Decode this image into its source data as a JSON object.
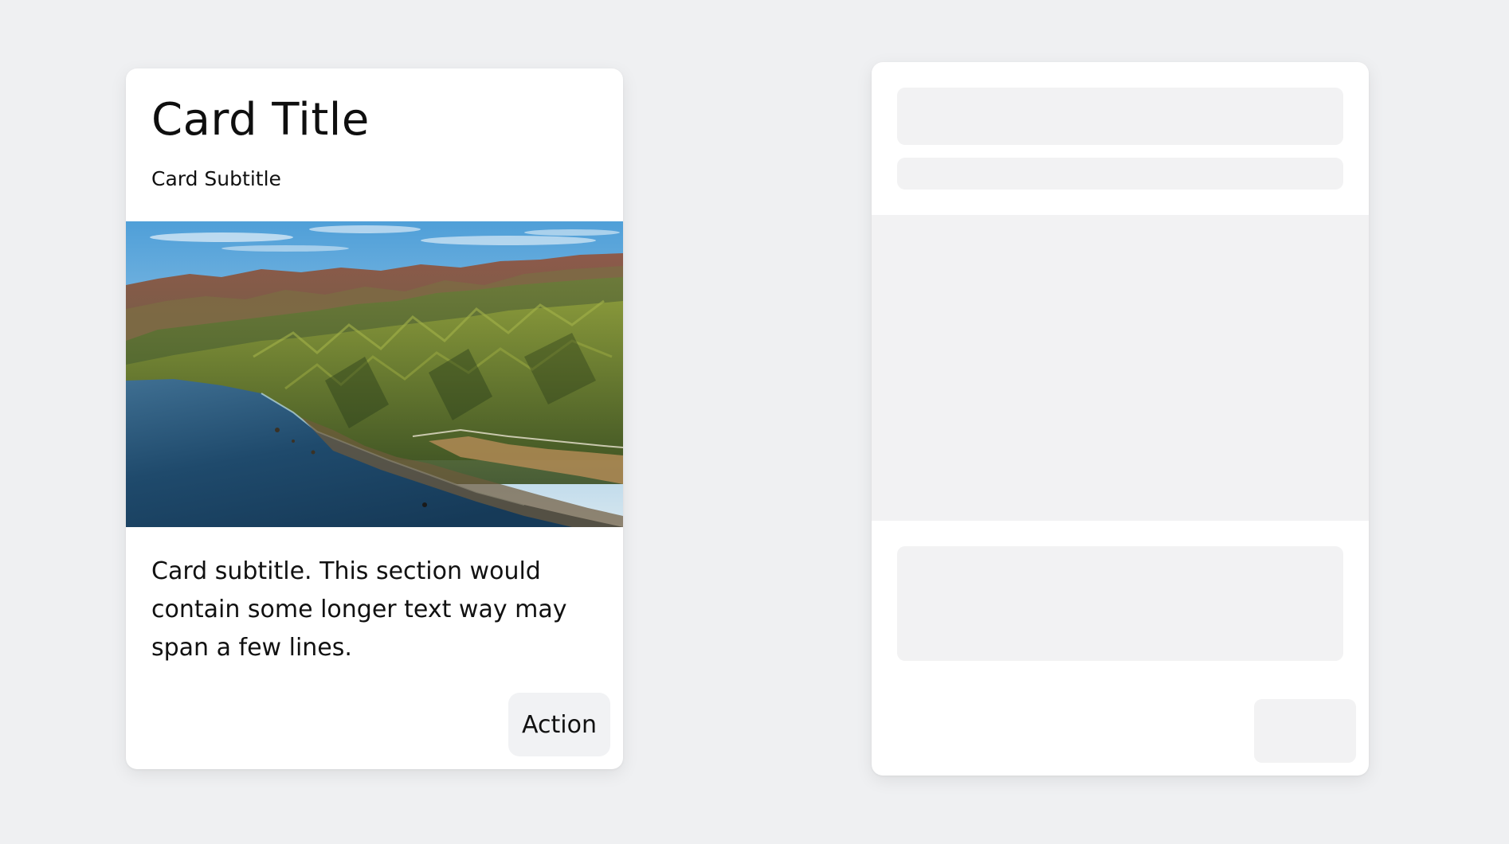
{
  "card": {
    "title": "Card Title",
    "subtitle": "Card Subtitle",
    "image_alt": "aerial coastal mountains landscape",
    "body": "Card subtitle. This section would contain some longer text way may span a few lines.",
    "action_label": "Action"
  },
  "skeleton": {
    "placeholders": [
      "title",
      "subtitle",
      "media",
      "body",
      "action"
    ]
  },
  "colors": {
    "page_background": "#eff0f2",
    "card_background": "#ffffff",
    "skeleton_fill": "#f2f2f3",
    "button_background": "#f1f2f4",
    "text": "#111111"
  }
}
